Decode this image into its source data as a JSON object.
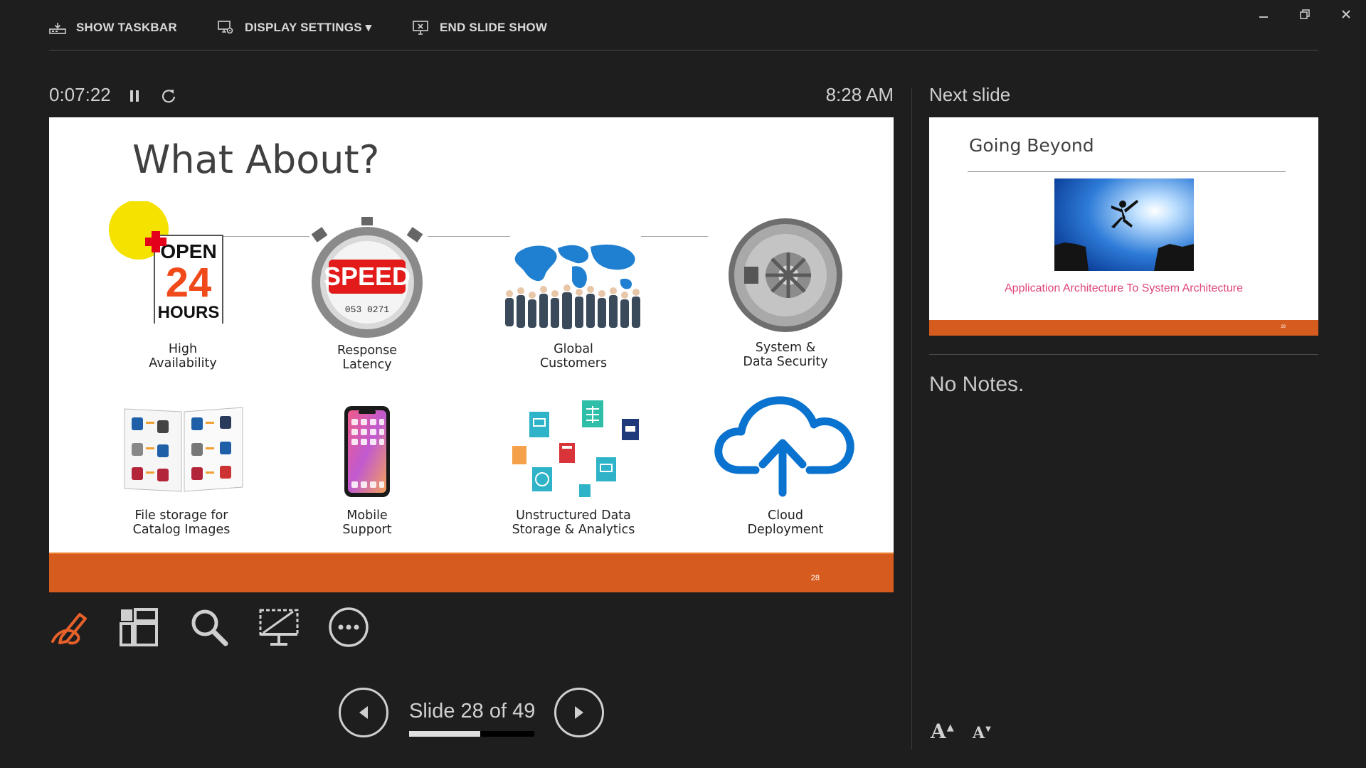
{
  "toolbar": {
    "show_taskbar": "SHOW TASKBAR",
    "display_settings": "DISPLAY SETTINGS ▾",
    "end_slide_show": "END SLIDE SHOW"
  },
  "window_controls": {
    "minimize": "minimize-icon",
    "restore": "restore-icon",
    "close": "close-icon"
  },
  "timer": {
    "elapsed": "0:07:22",
    "clock": "8:28 AM"
  },
  "current_slide": {
    "title": "What About?",
    "items": [
      {
        "label_1": "High",
        "label_2": "Availability",
        "icon": "open-24-hours-sign"
      },
      {
        "label_1": "Response",
        "label_2": "Latency",
        "icon": "speed-stopwatch"
      },
      {
        "label_1": "Global",
        "label_2": "Customers",
        "icon": "world-map-people"
      },
      {
        "label_1": "System &",
        "label_2": "Data Security",
        "icon": "vault-door"
      },
      {
        "label_1": "File storage for",
        "label_2": "Catalog Images",
        "icon": "catalog-book"
      },
      {
        "label_1": "Mobile",
        "label_2": "Support",
        "icon": "smartphone"
      },
      {
        "label_1": "Unstructured Data",
        "label_2": "Storage & Analytics",
        "icon": "document-files"
      },
      {
        "label_1": "Cloud",
        "label_2": "Deployment",
        "icon": "cloud-upload"
      }
    ],
    "number": "28",
    "colors": {
      "footer": "#d65b1e",
      "accent": "#ed7d31",
      "cloud": "#0a72cf"
    }
  },
  "next_slide": {
    "label": "Next slide",
    "title": "Going Beyond",
    "subtitle": "Application Architecture To System Architecture",
    "number": "29"
  },
  "notes": {
    "text": "No Notes."
  },
  "tools": [
    "pen-icon",
    "slides-grid-icon",
    "zoom-icon",
    "screen-icon",
    "more-options-icon"
  ],
  "navigation": {
    "counter": "Slide 28 of 49",
    "progress": 0.571
  },
  "font_controls": {
    "increase": "A",
    "decrease": "A"
  }
}
